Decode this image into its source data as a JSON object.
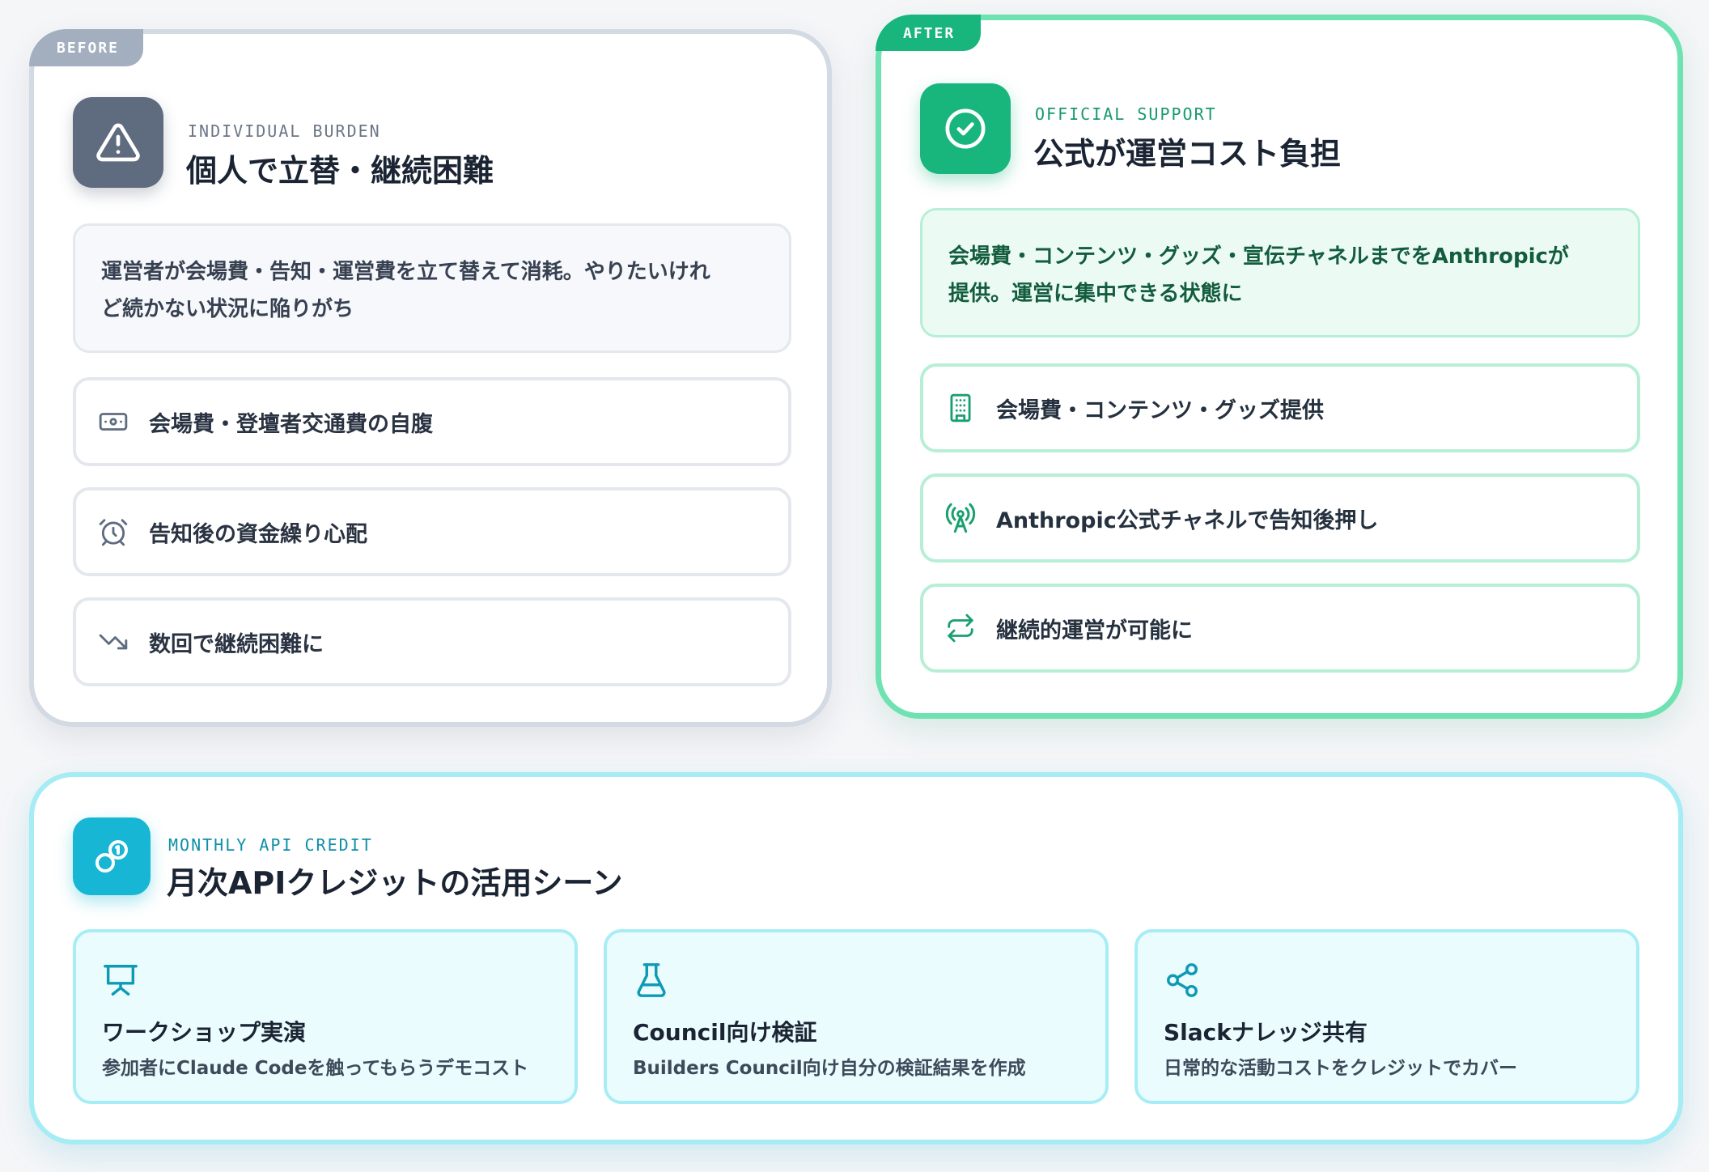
{
  "before": {
    "tag": "BEFORE",
    "eyebrow": "INDIVIDUAL BURDEN",
    "title": "個人で立替・継続困難",
    "icon": "warning-triangle-icon",
    "description_line1": "運営者が会場費・告知・運営費を立て替えて消耗。やりたいけれ",
    "description_line2": "ど続かない状況に陥りがち",
    "items": [
      {
        "icon": "money-icon",
        "label": "会場費・登壇者交通費の自腹"
      },
      {
        "icon": "alarm-clock-icon",
        "label": "告知後の資金繰り心配"
      },
      {
        "icon": "trending-down-icon",
        "label": "数回で継続困難に"
      }
    ]
  },
  "after": {
    "tag": "AFTER",
    "eyebrow": "OFFICIAL SUPPORT",
    "title": "公式が運営コスト負担",
    "icon": "check-circle-icon",
    "description_line1": "会場費・コンテンツ・グッズ・宣伝チャネルまでをAnthropicが",
    "description_line2": "提供。運営に集中できる状態に",
    "items": [
      {
        "icon": "building-icon",
        "label": "会場費・コンテンツ・グッズ提供"
      },
      {
        "icon": "broadcast-antenna-icon",
        "label": "Anthropic公式チャネルで告知後押し"
      },
      {
        "icon": "repeat-icon",
        "label": "継続的運営が可能に"
      }
    ]
  },
  "credit": {
    "eyebrow": "MONTHLY API CREDIT",
    "title": "月次APIクレジットの活用シーン",
    "icon": "coins-icon",
    "uses": [
      {
        "icon": "presentation-icon",
        "title": "ワークショップ実演",
        "desc": "参加者にClaude Codeを触ってもらうデモコスト"
      },
      {
        "icon": "flask-icon",
        "title": "Council向け検証",
        "desc": "Builders Council向け自分の検証結果を作成"
      },
      {
        "icon": "share-icon",
        "title": "Slackナレッジ共有",
        "desc": "日常的な活動コストをクレジットでカバー"
      }
    ]
  },
  "colors": {
    "before_accent": "#5f6b7f",
    "after_accent": "#18b57c",
    "credit_accent": "#16b6d4"
  }
}
